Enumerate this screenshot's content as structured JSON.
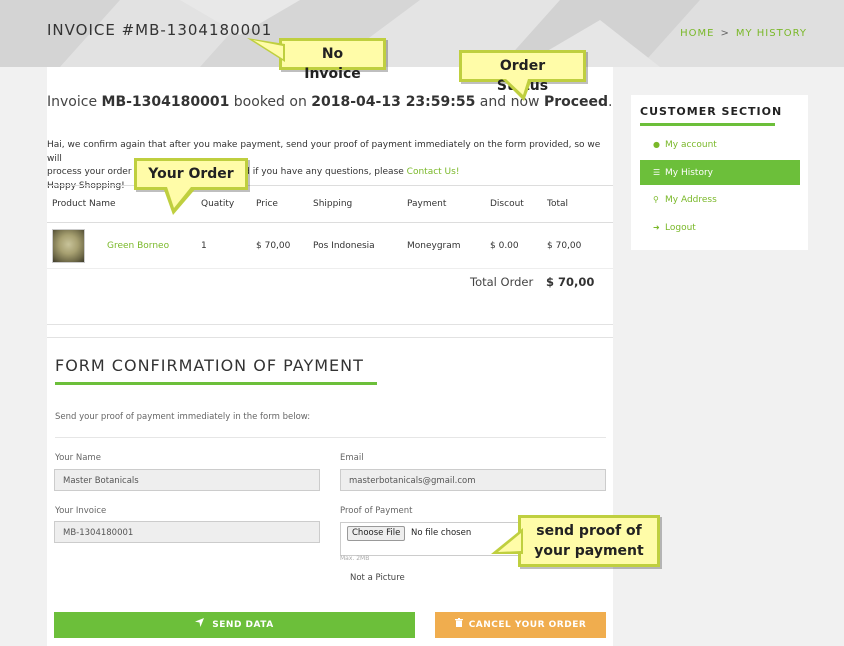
{
  "header": {
    "title": "INVOICE #MB-1304180001",
    "breadcrumb": {
      "home": "HOME",
      "separator": ">",
      "current": "MY HISTORY"
    }
  },
  "booking": {
    "prefix": "Invoice",
    "invoice_no": "MB-1304180001",
    "booked_on_label": "booked on",
    "datetime": "2018-04-13 23:59:55",
    "now_label": "and now",
    "status": "Proceed",
    "suffix": "."
  },
  "note": {
    "line1": "Hai, we confirm again that after you make payment, send your proof of payment immediately on the form provided, so we will",
    "line2_start": "process your order",
    "line2_mid": "And if you have any questions, please",
    "contact_link": "Contact Us!",
    "line3": "Happy Shopping!"
  },
  "order_table": {
    "columns": [
      "Product Name",
      "Quatity",
      "Price",
      "Shipping",
      "Payment",
      "Discout",
      "Total"
    ],
    "rows": [
      {
        "image": "product-thumbnail",
        "name": "Green Borneo",
        "qty": "1",
        "price": "$ 70,00",
        "shipping": "Pos Indonesia",
        "payment": "Moneygram",
        "discount": "$ 0.00",
        "total": "$ 70,00"
      }
    ],
    "total_label": "Total Order",
    "total_value": "$ 70,00"
  },
  "form": {
    "title": "FORM CONFIRMATION OF PAYMENT",
    "intro": "Send your proof of payment immediately in the form below:",
    "name_label": "Your Name",
    "name_value": "Master Botanicals",
    "email_label": "Email",
    "email_value": "masterbotanicals@gmail.com",
    "invoice_label": "Your Invoice",
    "invoice_value": "MB-1304180001",
    "proof_label": "Proof of Payment",
    "choose_file": "Choose File",
    "no_file": "No file chosen",
    "max_size": "Max. 2MB",
    "not_picture": "Not a Picture",
    "send_button": "SEND DATA",
    "cancel_button": "CANCEL YOUR ORDER"
  },
  "sidebar": {
    "title": "CUSTOMER SECTION",
    "items": [
      {
        "label": "My account",
        "icon": "user-icon",
        "active": false
      },
      {
        "label": "My History",
        "icon": "list-icon",
        "active": true
      },
      {
        "label": "My Address",
        "icon": "map-marker-icon",
        "active": false
      },
      {
        "label": "Logout",
        "icon": "logout-icon",
        "active": false
      }
    ]
  },
  "callouts": {
    "no_invoice": "No Invoice",
    "order_status": "Order Status",
    "your_order": "Your Order",
    "send_proof_line1": "send proof of",
    "send_proof_line2": "your payment"
  },
  "colors": {
    "accent": "#6cbf3a",
    "link": "#7ab829",
    "warning": "#f0ad4e",
    "callout_bg": "#fffca8",
    "callout_border": "#bfcf3f"
  }
}
